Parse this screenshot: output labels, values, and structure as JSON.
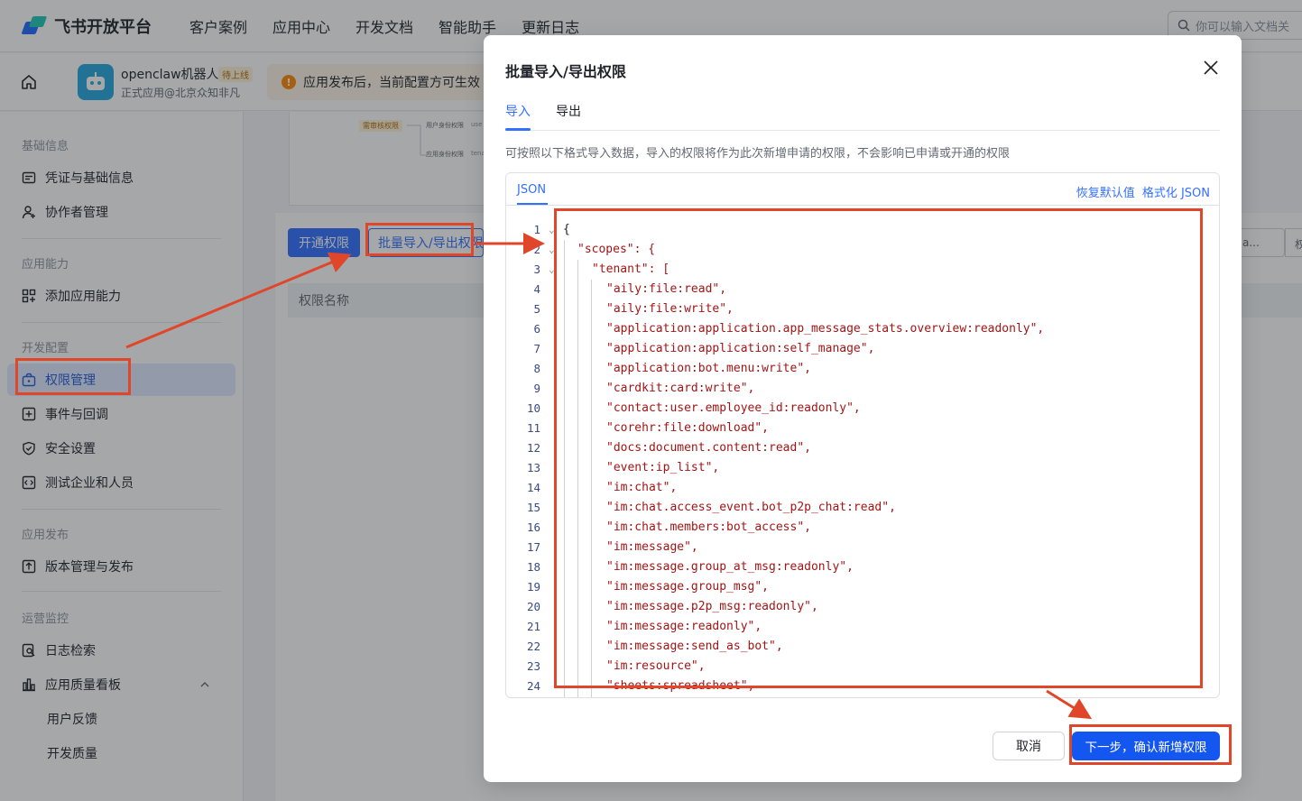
{
  "topnav": {
    "logo_text": "飞书开放平台",
    "items": [
      "客户案例",
      "应用中心",
      "开发文档",
      "智能助手",
      "更新日志"
    ],
    "search_placeholder": "你可以输入文档关"
  },
  "appbar": {
    "app_name": "openclaw机器人",
    "app_badge": "待上线",
    "app_sub": "正式应用@北京众知非凡",
    "notice": "应用发布后，当前配置方可生效"
  },
  "sidebar": {
    "groups": {
      "basic": "基础信息",
      "capability": "应用能力",
      "dev": "开发配置",
      "release": "应用发布",
      "ops": "运营监控"
    },
    "items": {
      "credentials": "凭证与基础信息",
      "collaborators": "协作者管理",
      "add_capability": "添加应用能力",
      "permissions": "权限管理",
      "events": "事件与回调",
      "security": "安全设置",
      "test_org": "测试企业和人员",
      "versions": "版本管理与发布",
      "logs": "日志检索",
      "quality": "应用质量看板",
      "feedback": "用户反馈",
      "dev_quality": "开发质量"
    }
  },
  "main": {
    "preview_tag": "需审核权限",
    "preview_line1": "用户身份权限",
    "preview_line1_tail": "use",
    "preview_line2": "应用身份权限",
    "preview_line2_tail": "tena",
    "open_button": "开通权限",
    "batch_button": "批量导入/导出权限",
    "table_header": "权限名称",
    "right_chip": "a...",
    "right_chip2": "权"
  },
  "modal": {
    "title": "批量导入/导出权限",
    "tabs": [
      "导入",
      "导出"
    ],
    "description": "可按照以下格式导入数据，导入的权限将作为此次新增申请的权限，不会影响已申请或开通的权限",
    "editor_tab": "JSON",
    "restore_default": "恢复默认值",
    "format_json": "格式化 JSON",
    "code_lines": [
      "{",
      "\"scopes\": {",
      "\"tenant\": [",
      "\"aily:file:read\",",
      "\"aily:file:write\",",
      "\"application:application.app_message_stats.overview:readonly\",",
      "\"application:application:self_manage\",",
      "\"application:bot.menu:write\",",
      "\"cardkit:card:write\",",
      "\"contact:user.employee_id:readonly\",",
      "\"corehr:file:download\",",
      "\"docs:document.content:read\",",
      "\"event:ip_list\",",
      "\"im:chat\",",
      "\"im:chat.access_event.bot_p2p_chat:read\",",
      "\"im:chat.members:bot_access\",",
      "\"im:message\",",
      "\"im:message.group_at_msg:readonly\",",
      "\"im:message.group_msg\",",
      "\"im:message.p2p_msg:readonly\",",
      "\"im:message:readonly\",",
      "\"im:message:send_as_bot\",",
      "\"im:resource\",",
      "\"sheets:spreadsheet\","
    ],
    "line_numbers": [
      "1",
      "2",
      "3",
      "4",
      "5",
      "6",
      "7",
      "8",
      "9",
      "10",
      "11",
      "12",
      "13",
      "14",
      "15",
      "16",
      "17",
      "18",
      "19",
      "20",
      "21",
      "22",
      "23",
      "24"
    ],
    "cancel": "取消",
    "confirm": "下一步，确认新增权限"
  },
  "colors": {
    "accent": "#3370ff",
    "annotation": "#e0472a",
    "confirm_bg": "#1456f0"
  }
}
